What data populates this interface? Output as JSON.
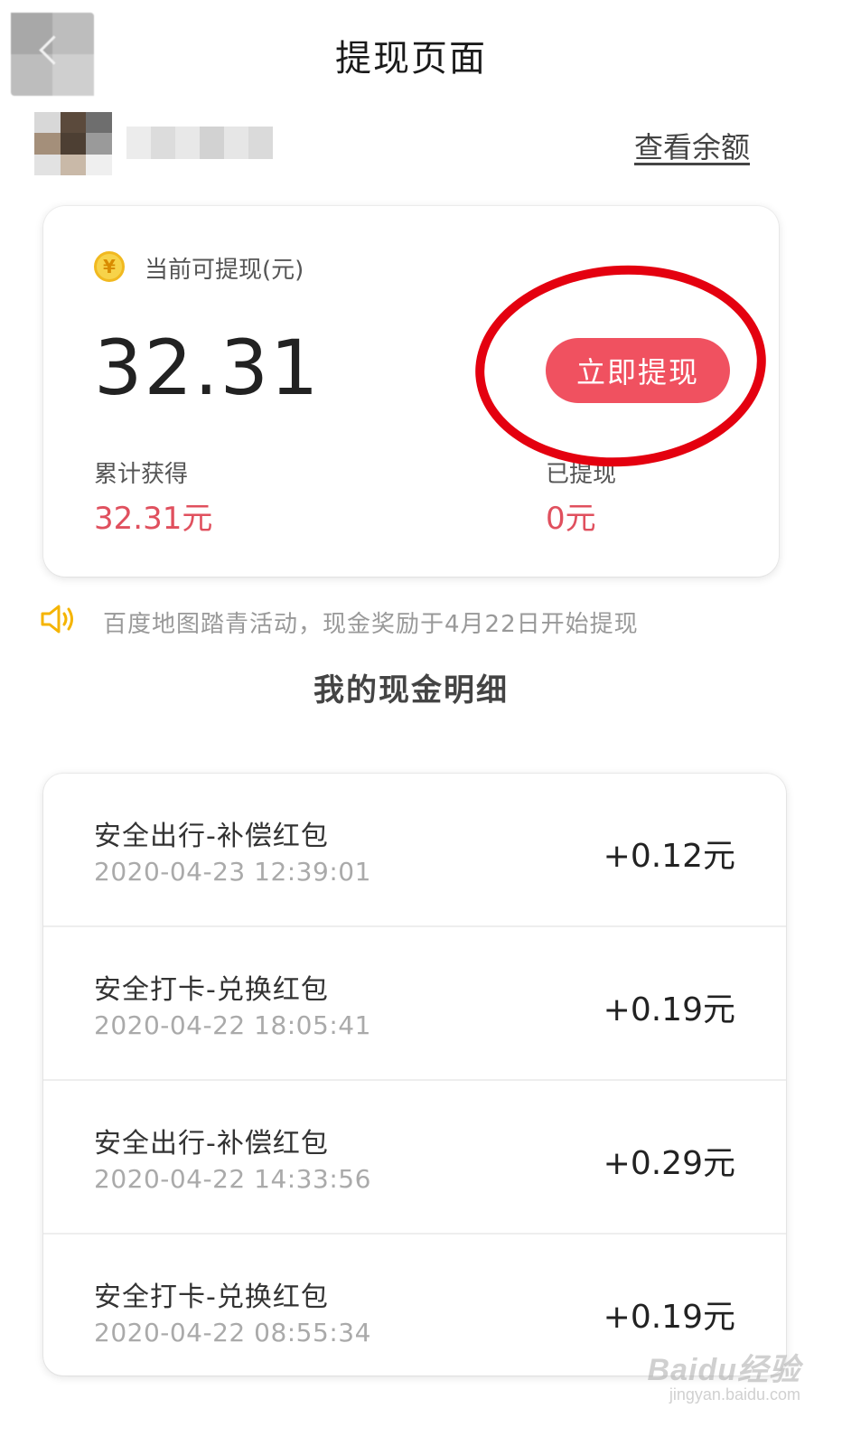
{
  "header": {
    "title": "提现页面",
    "back_icon": "chevron-left-icon"
  },
  "user": {
    "check_balance_label": "查看余额"
  },
  "balance_card": {
    "coin_icon": "yuan-coin-icon",
    "coin_glyph": "¥",
    "available_label": "当前可提现(元)",
    "available_amount": "32.31",
    "withdraw_button": "立即提现",
    "total_earned_label": "累计获得",
    "total_earned_value": "32.31元",
    "withdrawn_label": "已提现",
    "withdrawn_value": "0元",
    "accent_color": "#f05160",
    "highlight_color": "#e4000f"
  },
  "notice": {
    "icon": "speaker-icon",
    "text": "百度地图踏青活动，现金奖励于4月22日开始提现"
  },
  "details": {
    "title": "我的现金明细",
    "rows": [
      {
        "title": "安全出行-补偿红包",
        "time": "2020-04-23 12:39:01",
        "amount": "+0.12元"
      },
      {
        "title": "安全打卡-兑换红包",
        "time": "2020-04-22 18:05:41",
        "amount": "+0.19元"
      },
      {
        "title": "安全出行-补偿红包",
        "time": "2020-04-22 14:33:56",
        "amount": "+0.29元"
      },
      {
        "title": "安全打卡-兑换红包",
        "time": "2020-04-22 08:55:34",
        "amount": "+0.19元"
      }
    ]
  },
  "watermark": {
    "brand": "Baidu经验",
    "url": "jingyan.baidu.com"
  }
}
